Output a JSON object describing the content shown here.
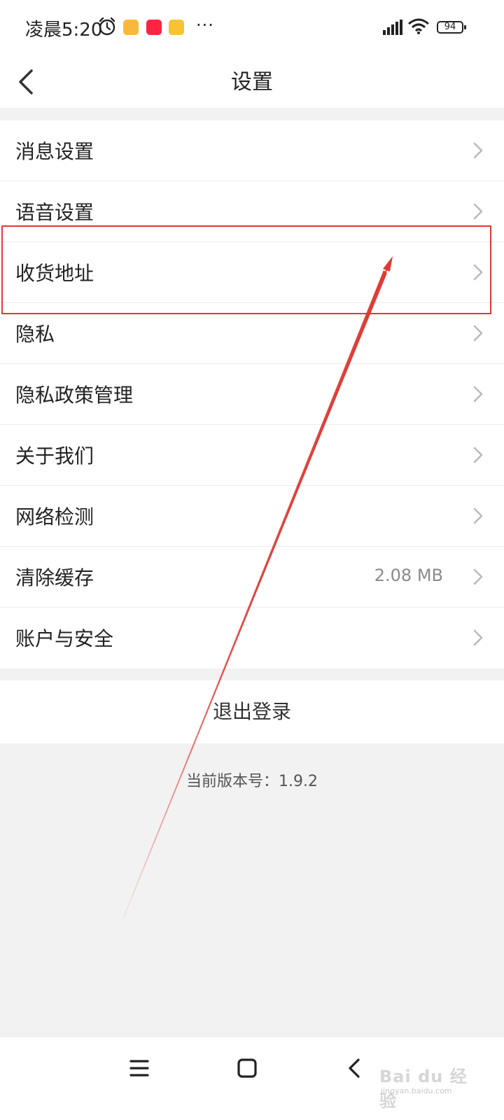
{
  "status_bar": {
    "time": "凌晨5:20",
    "more": "···",
    "battery": "94",
    "icons": [
      "alarm-icon",
      "notes-app-icon",
      "redbook-app-icon",
      "weibo-app-icon",
      "signal-hd-icon",
      "wifi-icon",
      "battery-icon"
    ]
  },
  "header": {
    "title": "设置",
    "back_icon": "chevron-left-icon"
  },
  "settings": {
    "items": [
      {
        "label": "消息设置",
        "value": ""
      },
      {
        "label": "语音设置",
        "value": ""
      },
      {
        "label": "收货地址",
        "value": ""
      },
      {
        "label": "隐私",
        "value": ""
      },
      {
        "label": "隐私政策管理",
        "value": ""
      },
      {
        "label": "关于我们",
        "value": ""
      },
      {
        "label": "网络检测",
        "value": ""
      },
      {
        "label": "清除缓存",
        "value": "2.08 MB"
      },
      {
        "label": "账户与安全",
        "value": ""
      }
    ]
  },
  "logout": {
    "label": "退出登录"
  },
  "version": {
    "text": "当前版本号：1.9.2"
  },
  "annotation": {
    "highlighted_item": "收货地址",
    "color": "#e03a34"
  },
  "nav_bar": {
    "icons": [
      "menu-icon",
      "home-icon",
      "back-icon"
    ]
  },
  "watermark": {
    "brand": "Bai du 经验",
    "url": "jingyan.baidu.com"
  }
}
